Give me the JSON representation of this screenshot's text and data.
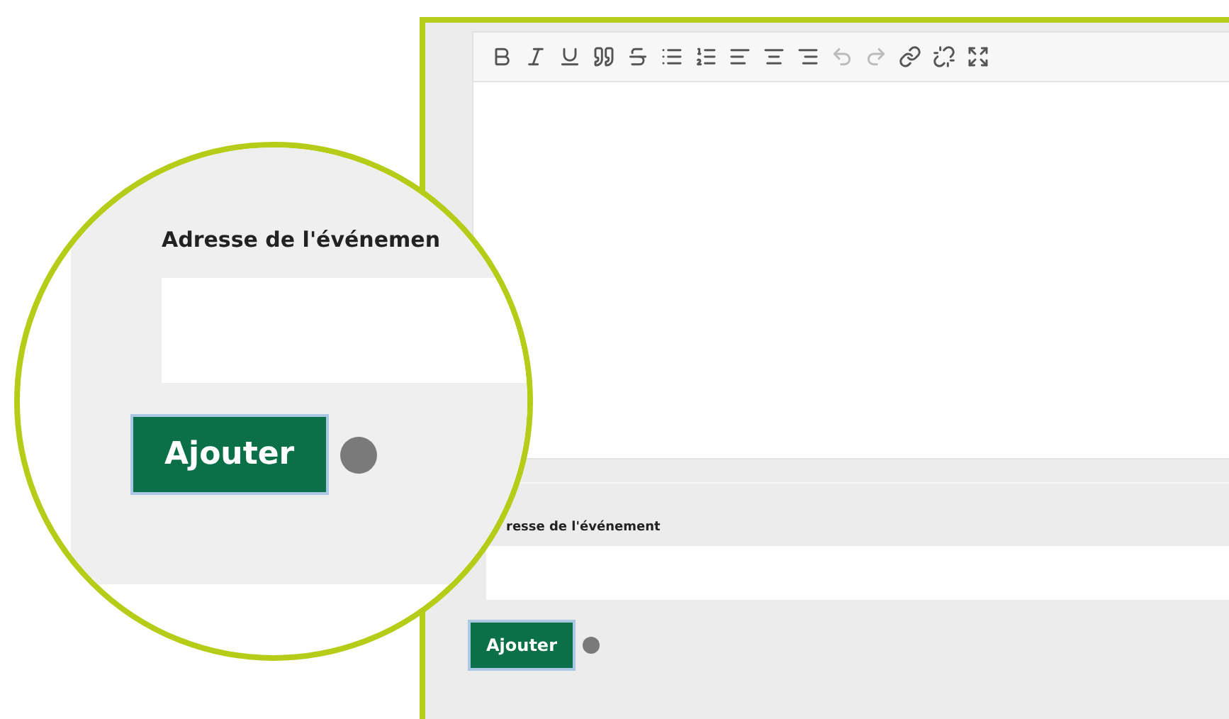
{
  "editor": {
    "toolbar": [
      {
        "kind": "bold",
        "disabled": false
      },
      {
        "kind": "italic",
        "disabled": false
      },
      {
        "kind": "underline",
        "disabled": false
      },
      {
        "kind": "quote",
        "disabled": false
      },
      {
        "kind": "strike",
        "disabled": false
      },
      {
        "kind": "bullets",
        "disabled": false
      },
      {
        "kind": "numbers",
        "disabled": false
      },
      {
        "kind": "align-left",
        "disabled": false
      },
      {
        "kind": "align-center",
        "disabled": false
      },
      {
        "kind": "align-right",
        "disabled": false
      },
      {
        "kind": "undo",
        "disabled": true
      },
      {
        "kind": "redo",
        "disabled": true
      },
      {
        "kind": "link",
        "disabled": false
      },
      {
        "kind": "unlink",
        "disabled": false
      },
      {
        "kind": "fullscreen",
        "disabled": false
      }
    ]
  },
  "address": {
    "label": "resse de l'événement"
  },
  "submit": {
    "label": "Ajouter"
  },
  "magnifier": {
    "label": "Adresse de l'événemen",
    "button": "Ajouter"
  }
}
